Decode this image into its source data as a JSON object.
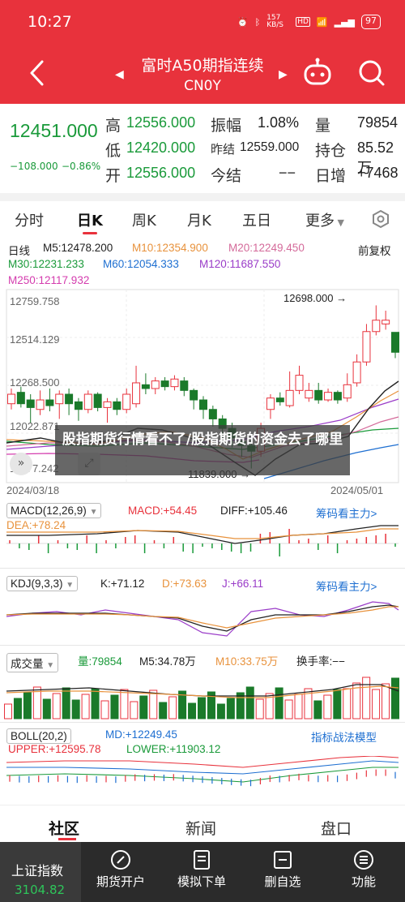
{
  "status_bar": {
    "time": "10:27",
    "net_speed": "157 KB/S",
    "battery": "97"
  },
  "nav": {
    "title": "富时A50期指连续",
    "code": "CN0Y"
  },
  "quote": {
    "price": "12451.000",
    "change": "−108.000",
    "change_pct": "−0.86%",
    "high_label": "高",
    "high": "12556.000",
    "low_label": "低",
    "low": "12420.000",
    "open_label": "开",
    "open": "12556.000",
    "amp_label": "振幅",
    "amp": "1.08%",
    "prev_settle_label": "昨结",
    "prev_settle": "12559.000",
    "settle_label": "今结",
    "settle": "−−",
    "vol_label": "量",
    "vol": "79854",
    "oi_label": "持仓",
    "oi": "85.52万",
    "oi_chg_label": "日增",
    "oi_chg": "+7468"
  },
  "tabs": [
    "分时",
    "日K",
    "周K",
    "月K",
    "五日",
    "更多"
  ],
  "active_tab": 1,
  "kline": {
    "label": "日线",
    "ma5": "M5:12478.200",
    "ma10": "M10:12354.900",
    "ma20": "M20:12249.450",
    "adjust": "前复权",
    "ma30": "M30:12231.233",
    "ma60": "M60:12054.333",
    "ma120": "M120:11687.550",
    "ma250": "M250:12117.932",
    "y_ticks": [
      "12759.758",
      "12514.129",
      "12268.500",
      "12022.871",
      "11777.242"
    ],
    "max_mark": "12698.000",
    "min_mark": "11839.000",
    "date_start": "2024/03/18",
    "date_end": "2024/05/01"
  },
  "macd": {
    "selector": "MACD(12,26,9)",
    "macd": "MACD:+54.45",
    "diff": "DIFF:+105.46",
    "dea": "DEA:+78.24",
    "link": "筹码看主力>"
  },
  "kdj": {
    "selector": "KDJ(9,3,3)",
    "k": "K:+71.12",
    "d": "D:+73.63",
    "j": "J:+66.11",
    "link": "筹码看主力>"
  },
  "volume": {
    "selector": "成交量",
    "vol": "量:79854",
    "m5": "M5:34.78万",
    "m10": "M10:33.75万",
    "turnover": "换手率:−−"
  },
  "boll": {
    "selector": "BOLL(20,2)",
    "md": "MD:+12249.45",
    "upper": "UPPER:+12595.78",
    "lower": "LOWER:+11903.12",
    "link": "指标战法模型"
  },
  "overlay_text": "股指期货行情看不了/股指期货的资金去了哪里",
  "bottom_tabs": [
    "社区",
    "新闻",
    "盘口"
  ],
  "toolbar": {
    "index_name": "上证指数",
    "index_value": "3104.82",
    "items": [
      "期货开户",
      "模拟下单",
      "删自选",
      "功能"
    ]
  },
  "chart_data": {
    "type": "candlestick",
    "title": "富时A50期指连续 日K",
    "x_range": [
      "2024/03/18",
      "2024/05/01"
    ],
    "ylim": [
      11777.242,
      12759.758
    ],
    "y_ticks": [
      12759.758,
      12514.129,
      12268.5,
      12022.871,
      11777.242
    ],
    "max_high": 12698.0,
    "min_low": 11839.0,
    "candles": [
      {
        "o": 12180,
        "c": 12230,
        "h": 12260,
        "l": 12150
      },
      {
        "o": 12240,
        "c": 12180,
        "h": 12270,
        "l": 12160
      },
      {
        "o": 12200,
        "c": 12160,
        "h": 12230,
        "l": 12080
      },
      {
        "o": 12150,
        "c": 12200,
        "h": 12250,
        "l": 12120
      },
      {
        "o": 12200,
        "c": 12170,
        "h": 12260,
        "l": 12140
      },
      {
        "o": 12180,
        "c": 12230,
        "h": 12250,
        "l": 12100
      },
      {
        "o": 12230,
        "c": 12180,
        "h": 12260,
        "l": 12120
      },
      {
        "o": 12190,
        "c": 12150,
        "h": 12210,
        "l": 12090
      },
      {
        "o": 12150,
        "c": 12230,
        "h": 12250,
        "l": 12130
      },
      {
        "o": 12230,
        "c": 12160,
        "h": 12240,
        "l": 12140
      },
      {
        "o": 12160,
        "c": 12190,
        "h": 12210,
        "l": 12080
      },
      {
        "o": 12190,
        "c": 12150,
        "h": 12210,
        "l": 12120
      },
      {
        "o": 12150,
        "c": 12230,
        "h": 12260,
        "l": 12130
      },
      {
        "o": 12180,
        "c": 12290,
        "h": 12380,
        "l": 12160
      },
      {
        "o": 12280,
        "c": 12260,
        "h": 12340,
        "l": 12230
      },
      {
        "o": 12260,
        "c": 12300,
        "h": 12320,
        "l": 12230
      },
      {
        "o": 12300,
        "c": 12270,
        "h": 12320,
        "l": 12250
      },
      {
        "o": 12270,
        "c": 12310,
        "h": 12330,
        "l": 12250
      },
      {
        "o": 12300,
        "c": 12250,
        "h": 12320,
        "l": 12220
      },
      {
        "o": 12250,
        "c": 12200,
        "h": 12260,
        "l": 12150
      },
      {
        "o": 12200,
        "c": 12150,
        "h": 12220,
        "l": 12100
      },
      {
        "o": 12150,
        "c": 12100,
        "h": 12170,
        "l": 12060
      },
      {
        "o": 12100,
        "c": 12050,
        "h": 12120,
        "l": 12000
      },
      {
        "o": 12050,
        "c": 12000,
        "h": 12080,
        "l": 11950
      },
      {
        "o": 11980,
        "c": 11960,
        "h": 12010,
        "l": 11900
      },
      {
        "o": 11960,
        "c": 11930,
        "h": 11990,
        "l": 11839
      },
      {
        "o": 11930,
        "c": 12050,
        "h": 12080,
        "l": 11900
      },
      {
        "o": 12150,
        "c": 12210,
        "h": 12230,
        "l": 12100
      },
      {
        "o": 12210,
        "c": 12190,
        "h": 12240,
        "l": 12170
      },
      {
        "o": 12170,
        "c": 12250,
        "h": 12350,
        "l": 12160
      },
      {
        "o": 12250,
        "c": 12330,
        "h": 12380,
        "l": 12230
      },
      {
        "o": 12210,
        "c": 12250,
        "h": 12290,
        "l": 12190
      },
      {
        "o": 12250,
        "c": 12200,
        "h": 12290,
        "l": 12180
      },
      {
        "o": 12200,
        "c": 12240,
        "h": 12260,
        "l": 12190
      },
      {
        "o": 12240,
        "c": 12200,
        "h": 12250,
        "l": 12180
      },
      {
        "o": 12210,
        "c": 12280,
        "h": 12340,
        "l": 12190
      },
      {
        "o": 12290,
        "c": 12400,
        "h": 12440,
        "l": 12270
      },
      {
        "o": 12400,
        "c": 12560,
        "h": 12600,
        "l": 12380
      },
      {
        "o": 12560,
        "c": 12620,
        "h": 12698,
        "l": 12540
      },
      {
        "o": 12600,
        "c": 12620,
        "h": 12670,
        "l": 12570
      },
      {
        "o": 12556,
        "c": 12451,
        "h": 12556,
        "l": 12420
      }
    ]
  }
}
